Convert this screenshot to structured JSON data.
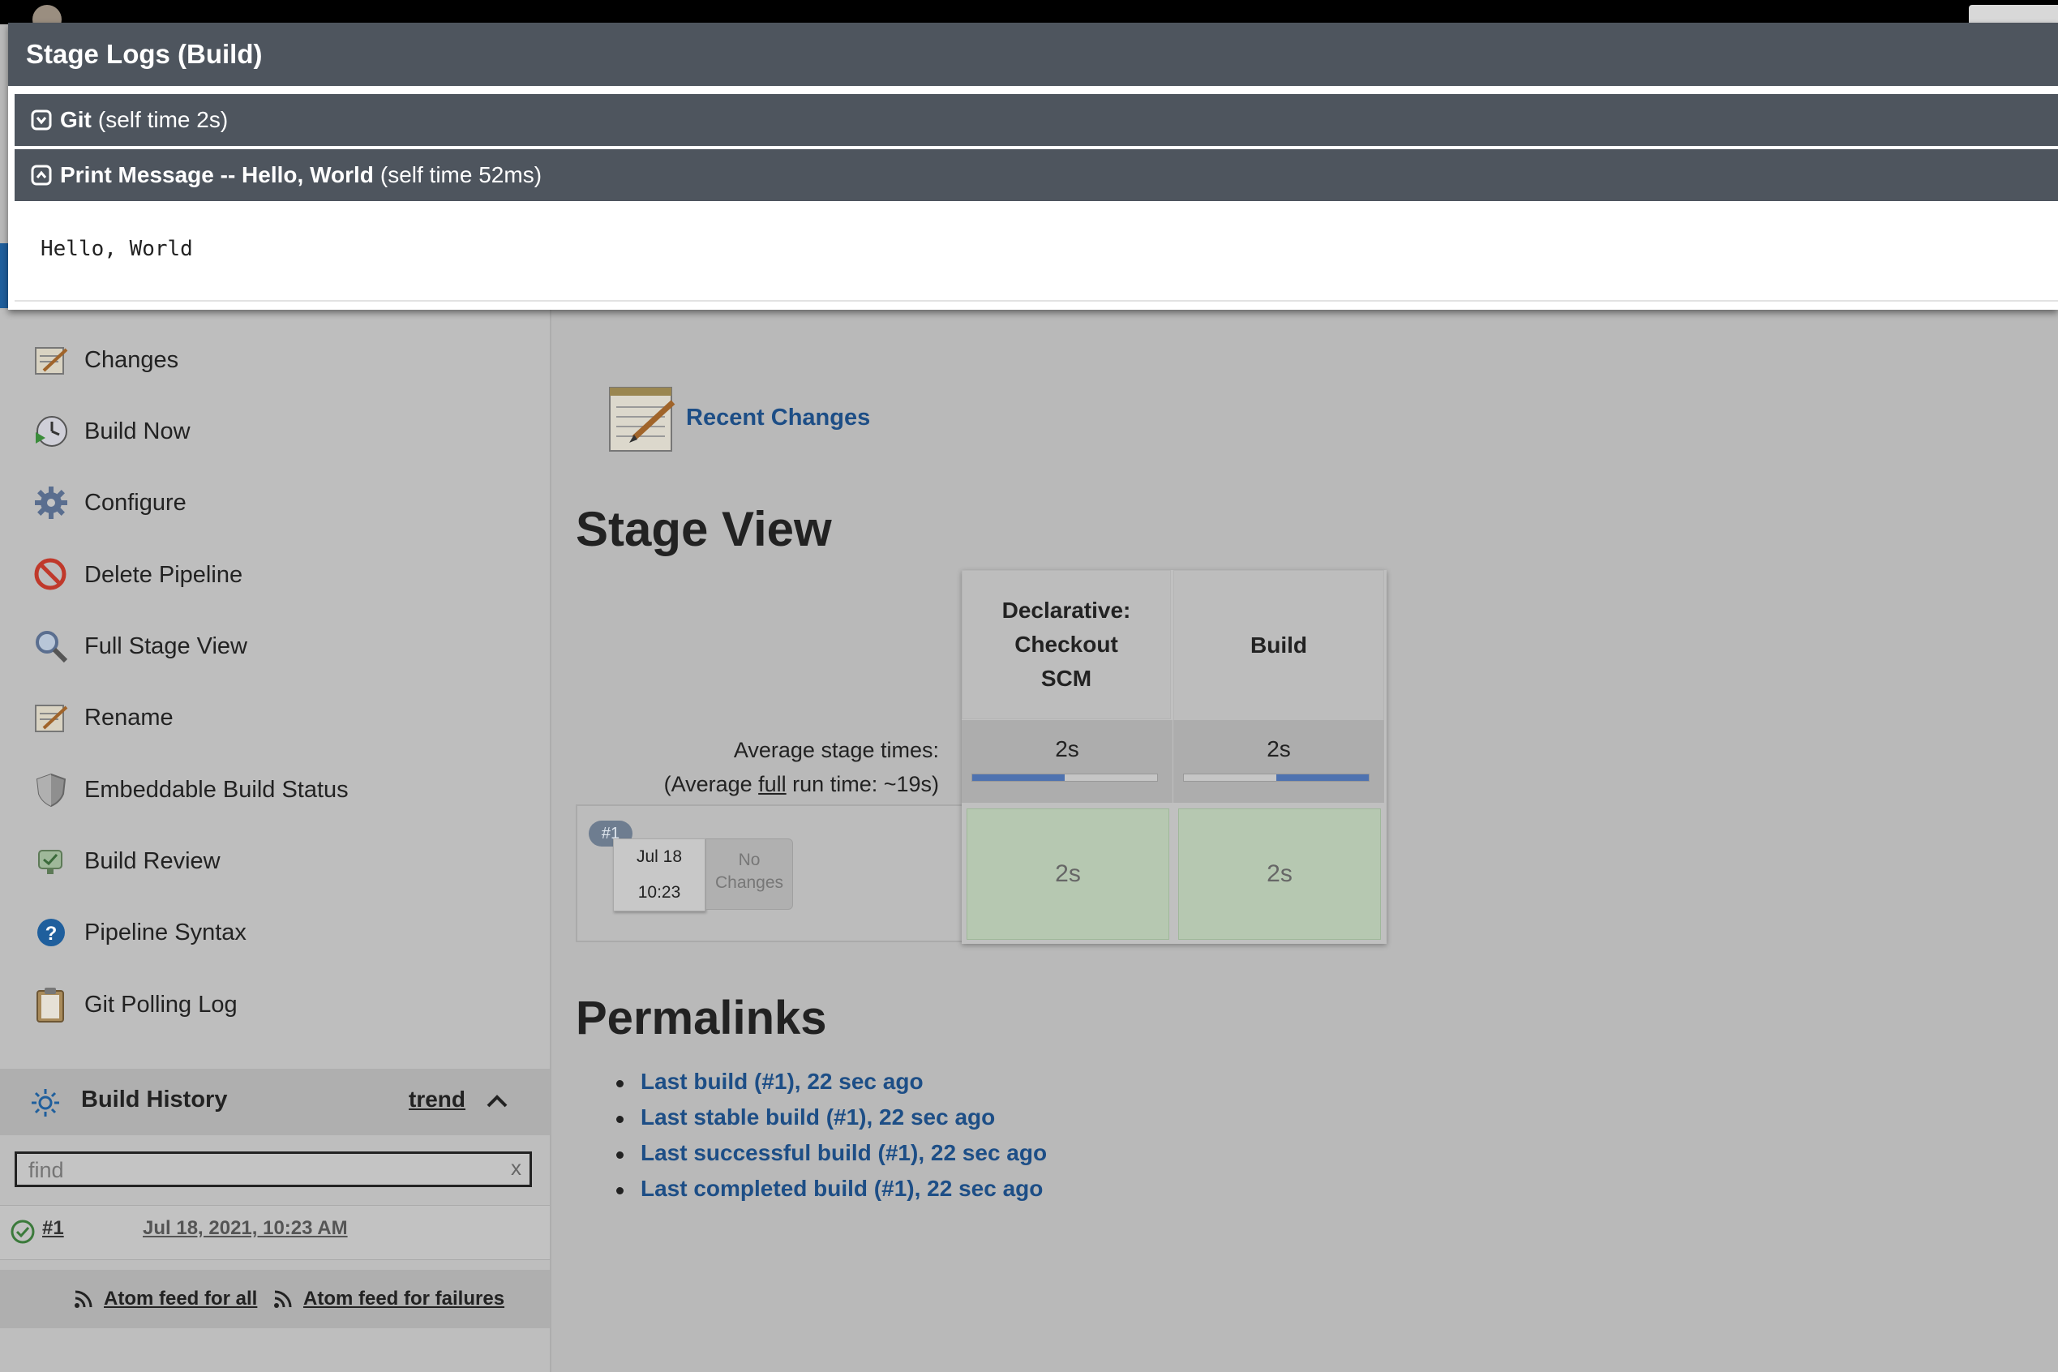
{
  "modal": {
    "title": "Stage Logs (Build)",
    "steps": [
      {
        "name": "Git",
        "time": "(self time 2s)",
        "state": "collapsed"
      },
      {
        "name": "Print Message -- Hello, World",
        "time": "(self time 52ms)",
        "state": "expanded"
      }
    ],
    "log_output": "Hello, World"
  },
  "sidebar": {
    "tasks": [
      {
        "label": "Changes",
        "icon": "notepad-icon"
      },
      {
        "label": "Build Now",
        "icon": "clock-play-icon"
      },
      {
        "label": "Configure",
        "icon": "gear-icon"
      },
      {
        "label": "Delete Pipeline",
        "icon": "no-entry-icon"
      },
      {
        "label": "Full Stage View",
        "icon": "magnifier-icon"
      },
      {
        "label": "Rename",
        "icon": "notepad-icon"
      },
      {
        "label": "Embeddable Build Status",
        "icon": "shield-icon"
      },
      {
        "label": "Build Review",
        "icon": "review-icon"
      },
      {
        "label": "Pipeline Syntax",
        "icon": "help-icon"
      },
      {
        "label": "Git Polling Log",
        "icon": "clipboard-icon"
      }
    ]
  },
  "build_history": {
    "title": "Build History",
    "trend_label": "trend",
    "find_placeholder": "find",
    "clear_label": "x",
    "builds": [
      {
        "number": "#1",
        "date": "Jul 18, 2021, 10:23 AM",
        "status": "success"
      }
    ],
    "feed_all": "Atom feed for all",
    "feed_failures": "Atom feed for failures"
  },
  "main": {
    "recent_changes": "Recent Changes",
    "stage_view_title": "Stage View",
    "avg_stage_label": "Average stage times:",
    "avg_run_prefix": "(Average ",
    "avg_run_link": "full",
    "avg_run_suffix": " run time: ~19s)",
    "stages": [
      {
        "name": "Declarative: Checkout SCM",
        "avg": "2s",
        "avg_bar": {
          "start": 0.0,
          "fraction": 0.5
        },
        "run_time": "2s"
      },
      {
        "name": "Build",
        "avg": "2s",
        "avg_bar": {
          "start": 0.5,
          "fraction": 0.5
        },
        "run_time": "2s"
      }
    ],
    "run": {
      "badge": "#1",
      "date": "Jul 18",
      "time": "10:23",
      "changes_line1": "No",
      "changes_line2": "Changes"
    },
    "permalinks_title": "Permalinks",
    "permalinks": [
      "Last build (#1), 22 sec ago",
      "Last stable build (#1), 22 sec ago",
      "Last successful build (#1), 22 sec ago",
      "Last completed build (#1), 22 sec ago"
    ]
  },
  "colors": {
    "modal_header": "#4e555e",
    "link_blue": "#1d4e86",
    "success_cell": "#b6c8b1",
    "progress_fill": "#4e72b0"
  }
}
